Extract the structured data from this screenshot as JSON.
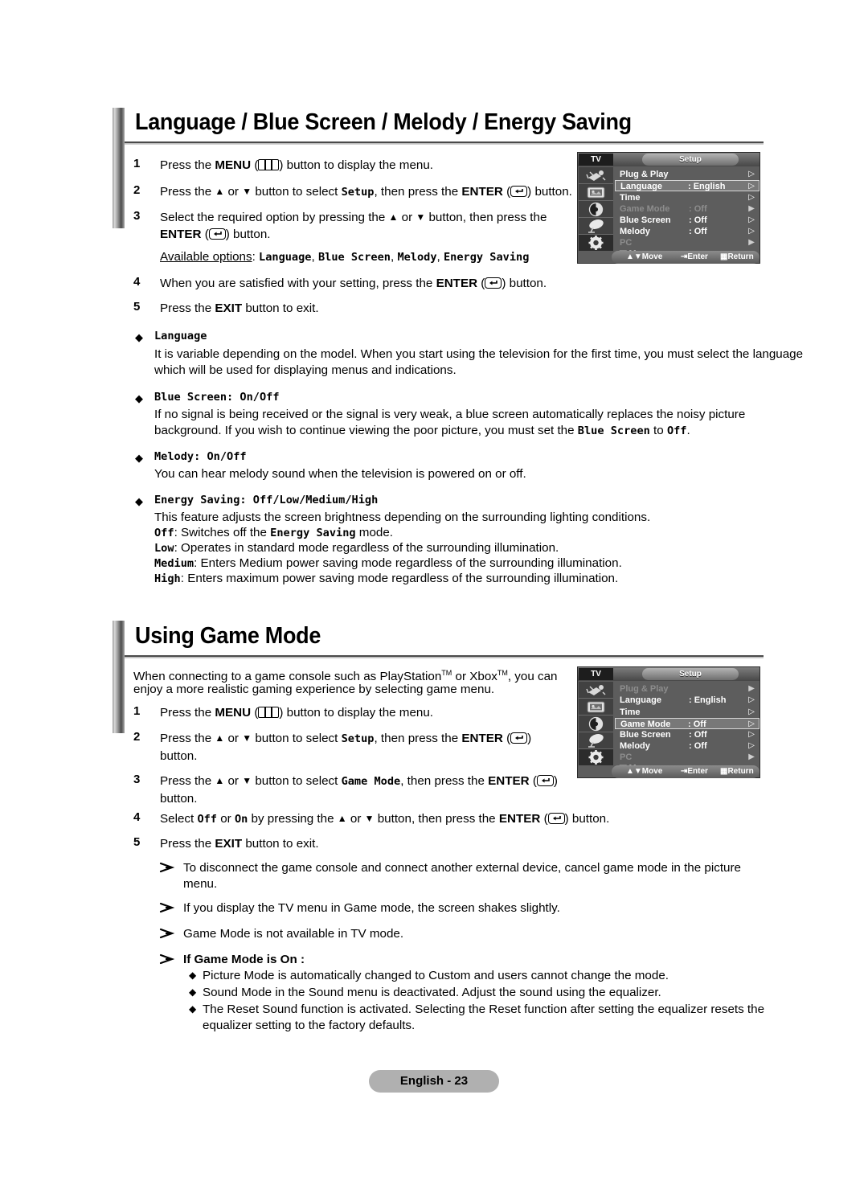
{
  "page": {
    "number_badge": "English - 23",
    "background": "#ffffff"
  },
  "section1": {
    "title": "Language / Blue Screen / Melody / Energy Saving",
    "steps": [
      {
        "num": "1",
        "pre": "Press the ",
        "bold1": "MENU",
        "mid": " (",
        "glyph": "menu-icon",
        "post": ") button to display the menu."
      },
      {
        "num": "2",
        "text": "Press the ▲ or ▼ button to select Setup, then press the ENTER (  ) button."
      },
      {
        "num": "3",
        "text": "Select the required option by pressing the ▲ or ▼ button, then press the ENTER (  ) button."
      },
      {
        "num": "4",
        "text": "When you are satisfied with your setting, press the ENTER (  ) button."
      },
      {
        "num": "5",
        "text": "Press the EXIT button to exit."
      }
    ],
    "step2_a": "Press the ",
    "step2_tri1": "▲",
    "step2_or": " or ",
    "step2_tri2": "▼",
    "step2_b": " button to select ",
    "step2_mono": "Setup",
    "step2_c": ", then press the ",
    "step2_enter": "ENTER",
    "step2_d": " (",
    "step2_e": ") button.",
    "step3_a": "Select the required option by pressing the ",
    "step3_b": " button, then press the",
    "step3_enter": "ENTER",
    "step3_c": " (",
    "step3_d": ") button.",
    "available_label": "Available options",
    "available_colon": ": ",
    "available_options": [
      "Language",
      "Blue Screen",
      "Melody",
      "Energy Saving"
    ],
    "step4_a": "When you are satisfied with your setting, press the ",
    "step4_enter": "ENTER",
    "step4_b": " (",
    "step4_c": ") button.",
    "step5_a": "Press the ",
    "step5_exit": "EXIT",
    "step5_b": " button to exit.",
    "bullets": [
      {
        "head_mono": "Language",
        "head_tail": "",
        "lines": [
          "It is variable depending on the model. When you start using the television for the first time, you must select the language",
          "which will be used for displaying menus and indications."
        ]
      },
      {
        "head_mono": "Blue Screen",
        "head_tail": ": On/Off",
        "lines": [
          "If no signal is being received or the signal is very weak, a blue screen automatically replaces the noisy picture",
          "background. If you wish to continue viewing the poor picture, you must set the Blue Screen to Off."
        ]
      },
      {
        "head_mono": "Melody",
        "head_tail": ": On/Off",
        "lines": [
          "You can hear melody sound when the television is powered on or off."
        ]
      },
      {
        "head_mono": "Energy Saving",
        "head_tail": ": Off/Low/Medium/High",
        "lines": [
          "This feature adjusts the screen brightness depending on the surrounding lighting conditions.",
          "Off: Switches off the Energy Saving mode.",
          "Low: Operates in standard mode regardless of the surrounding illumination.",
          "Medium: Enters Medium power saving mode regardless of the surrounding illumination.",
          "High: Enters maximum power saving mode regardless of the surrounding illumination."
        ]
      }
    ],
    "bluescreen_l2_a": "background. If you wish to continue viewing the poor picture, you must set the ",
    "bluescreen_l2_m1": "Blue Screen",
    "bluescreen_l2_b": " to ",
    "bluescreen_l2_m2": "Off",
    "bluescreen_l2_c": ".",
    "es_l1": "This feature adjusts the screen brightness depending on the surrounding lighting conditions.",
    "es_off_k": "Off",
    "es_off_a": ": Switches off the ",
    "es_off_m": "Energy Saving",
    "es_off_b": " mode.",
    "es_low_k": "Low",
    "es_low_t": ": Operates in standard mode regardless of the surrounding illumination.",
    "es_med_k": "Medium",
    "es_med_t": ": Enters Medium power saving mode regardless of the surrounding illumination.",
    "es_high_k": "High",
    "es_high_t": ": Enters maximum power saving mode regardless of the surrounding illumination."
  },
  "section2": {
    "title": "Using Game Mode",
    "intro_l1_a": "When connecting to a game console such as PlayStation",
    "intro_tm1": "TM",
    "intro_l1_b": " or Xbox",
    "intro_tm2": "TM",
    "intro_l1_c": ", you can",
    "intro_l2": "enjoy a more realistic gaming experience by selecting game menu.",
    "step1_a": "Press the ",
    "step1_menu": "MENU",
    "step1_b": " (",
    "step1_c": ") button to display the menu.",
    "step2_a": "Press the ",
    "step2_b": " button to select ",
    "step2_mono": "Setup",
    "step2_c": ", then press the ",
    "step2_enter": "ENTER",
    "step2_d": " (",
    "step2_e": ")",
    "step2_l2": "button.",
    "step3_a": "Press the ",
    "step3_b": " button to select ",
    "step3_mono": "Game Mode",
    "step3_c": ", then press the ",
    "step3_enter": "ENTER",
    "step3_d": " (",
    "step3_e": ")",
    "step3_l2": "button.",
    "step4_a": "Select ",
    "step4_m1": "Off",
    "step4_b": " or ",
    "step4_m2": "On",
    "step4_c": " by pressing the ",
    "step4_d": " button, then press the ",
    "step4_enter": "ENTER",
    "step4_e": " (",
    "step4_f": ") button.",
    "step5_a": "Press the ",
    "step5_exit": "EXIT",
    "step5_b": " button to exit.",
    "notes": [
      {
        "lines": [
          "To disconnect the game console and connect another external device, cancel game mode in the picture",
          "menu."
        ]
      },
      {
        "lines": [
          "If you display the TV menu in Game mode, the screen shakes slightly."
        ]
      },
      {
        "lines": [
          "Game Mode is not available in TV mode."
        ]
      }
    ],
    "gamemode_on_heading": "If Game Mode is On :",
    "gamemode_on_items": [
      {
        "lines": [
          "Picture Mode is automatically changed to Custom and users cannot change the mode."
        ]
      },
      {
        "lines": [
          "Sound Mode in the Sound menu is deactivated. Adjust the sound using the equalizer."
        ]
      },
      {
        "lines": [
          "The Reset Sound function is activated. Selecting the Reset function after setting the equalizer resets the",
          "equalizer setting to the factory defaults."
        ]
      }
    ]
  },
  "osd1": {
    "source_label": "TV",
    "tab_label": "Setup",
    "rows": [
      {
        "name": "Plug & Play",
        "value": "",
        "arrow": "▷",
        "state": "normal"
      },
      {
        "name": "Language",
        "value": ": English",
        "arrow": "▷",
        "state": "highlight"
      },
      {
        "name": "Time",
        "value": "",
        "arrow": "▷",
        "state": "normal"
      },
      {
        "name": "Game Mode",
        "value": ": Off",
        "arrow": "▶",
        "state": "dim"
      },
      {
        "name": "Blue Screen",
        "value": ": Off",
        "arrow": "▷",
        "state": "normal"
      },
      {
        "name": "Melody",
        "value": ": Off",
        "arrow": "▷",
        "state": "normal"
      },
      {
        "name": "PC",
        "value": "",
        "arrow": "▶",
        "state": "dim"
      }
    ],
    "more_label": "▽ More",
    "footer": {
      "move": "Move",
      "enter": "Enter",
      "return": "Return"
    },
    "icons": [
      "input-antenna-icon",
      "picture-icon",
      "sound-icon",
      "channel-dish-icon",
      "setup-gear-icon"
    ],
    "selected_icon_index": 4
  },
  "osd2": {
    "source_label": "TV",
    "tab_label": "Setup",
    "rows": [
      {
        "name": "Plug & Play",
        "value": "",
        "arrow": "▶",
        "state": "dim"
      },
      {
        "name": "Language",
        "value": ": English",
        "arrow": "▷",
        "state": "normal"
      },
      {
        "name": "Time",
        "value": "",
        "arrow": "▷",
        "state": "normal"
      },
      {
        "name": "Game Mode",
        "value": ": Off",
        "arrow": "▷",
        "state": "highlight"
      },
      {
        "name": "Blue Screen",
        "value": ": Off",
        "arrow": "▷",
        "state": "normal"
      },
      {
        "name": "Melody",
        "value": ": Off",
        "arrow": "▷",
        "state": "normal"
      },
      {
        "name": "PC",
        "value": "",
        "arrow": "▶",
        "state": "dim"
      }
    ],
    "more_label": "▽ More",
    "footer": {
      "move": "Move",
      "enter": "Enter",
      "return": "Return"
    },
    "icons": [
      "input-antenna-icon",
      "picture-icon",
      "sound-icon",
      "channel-dish-icon",
      "setup-gear-icon"
    ],
    "selected_icon_index": 4
  }
}
